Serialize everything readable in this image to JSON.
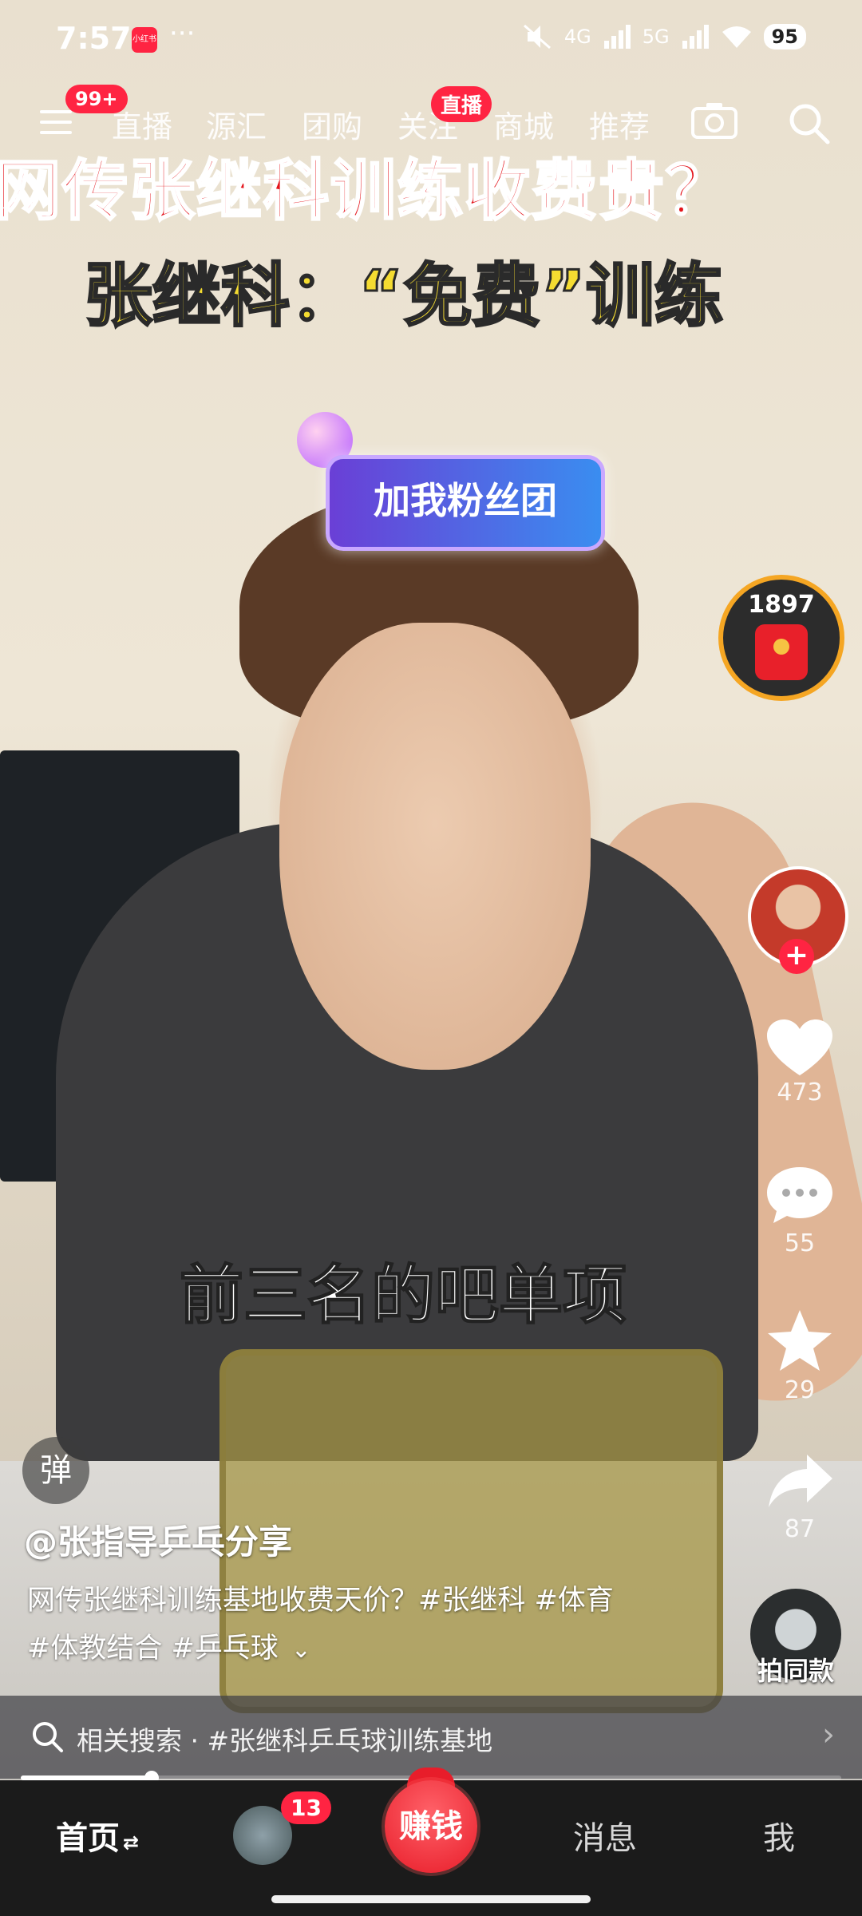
{
  "status_bar": {
    "time": "7:57",
    "app_mini_label": "小红书",
    "more_dots": "···",
    "network_1": "4G",
    "network_2": "5G",
    "battery": "95"
  },
  "top_nav": {
    "menu_badge": "99+",
    "tabs": [
      "直播",
      "源汇",
      "团购",
      "关注",
      "商城",
      "推荐"
    ],
    "live_badge": "直播"
  },
  "video": {
    "headline_1": "网传张继科训练收费贵？",
    "headline_2": "张继科：“免费”训练",
    "sticker": "加我粉丝团",
    "subtitle": "前三名的吧单项"
  },
  "side_actions": {
    "red_packet_count": "1897",
    "follow_plus": "+",
    "likes": "473",
    "comments": "55",
    "favorites": "29",
    "shares": "87",
    "same_style_label": "拍同款"
  },
  "post": {
    "danmu_label": "弹",
    "author": "@张指导乒乓分享",
    "desc_line1": "网传张继科训练基地收费天价？#张继科 #体育",
    "desc_line2": "#体教结合 #乒乓球",
    "expand": "⌄"
  },
  "related_search": {
    "text": "相关搜索 · #张继科乒乓球训练基地",
    "arrow": "›"
  },
  "progress": {
    "fraction": 0.16
  },
  "bottom_nav": {
    "home": "首页",
    "swap": "⇄",
    "avatar_badge": "13",
    "earn": "赚钱",
    "messages": "消息",
    "me": "我"
  },
  "colors": {
    "accent_red": "#ff2442",
    "headline_red": "#e4141b",
    "headline_yellow": "#f5dc31"
  },
  "icons": [
    "menu-icon",
    "camera-icon",
    "search-icon",
    "heart-icon",
    "comment-icon",
    "star-icon",
    "share-icon",
    "search-small-icon"
  ]
}
